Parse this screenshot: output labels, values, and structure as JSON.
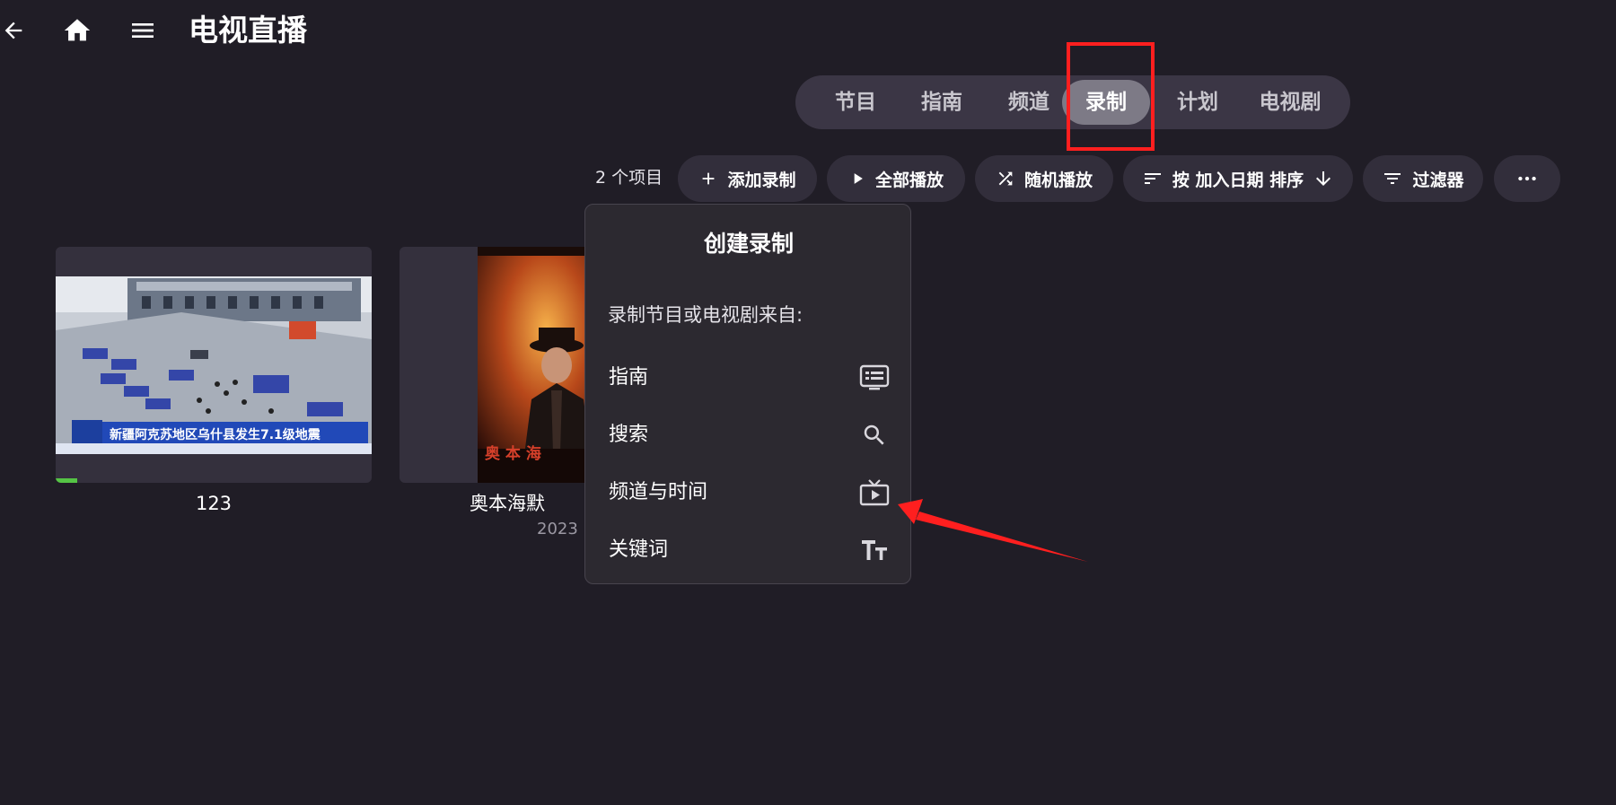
{
  "header": {
    "back_icon": "arrow-left-icon",
    "home_icon": "home-icon",
    "menu_icon": "hamburger-menu-icon",
    "title": "电视直播"
  },
  "tabs": [
    {
      "label": "节目",
      "active": false
    },
    {
      "label": "指南",
      "active": false
    },
    {
      "label": "频道",
      "active": false
    },
    {
      "label": "录制",
      "active": true
    },
    {
      "label": "计划",
      "active": false
    },
    {
      "label": "电视剧",
      "active": false
    }
  ],
  "toolbar": {
    "count": "2 个项目",
    "add_recording": "添加录制",
    "play_all": "全部播放",
    "shuffle": "随机播放",
    "sort": "按 加入日期 排序",
    "filter": "过滤器"
  },
  "cards": [
    {
      "title": "123",
      "caption": "新疆阿克苏地区乌什县发生7.1级地震",
      "progress": 0.07
    },
    {
      "title": "奥本海默",
      "year": "2023",
      "poster_text": "奥 本 海"
    }
  ],
  "popup": {
    "title": "创建录制",
    "subtitle": "录制节目或电视剧来自:",
    "items": [
      {
        "label": "指南",
        "icon": "guide-list-icon"
      },
      {
        "label": "搜索",
        "icon": "search-icon"
      },
      {
        "label": "频道与时间",
        "icon": "tv-play-icon"
      },
      {
        "label": "关键词",
        "icon": "text-size-icon"
      }
    ]
  },
  "colors": {
    "background": "#201d26",
    "annotation": "#ff1f1f",
    "progress": "#55c445"
  }
}
